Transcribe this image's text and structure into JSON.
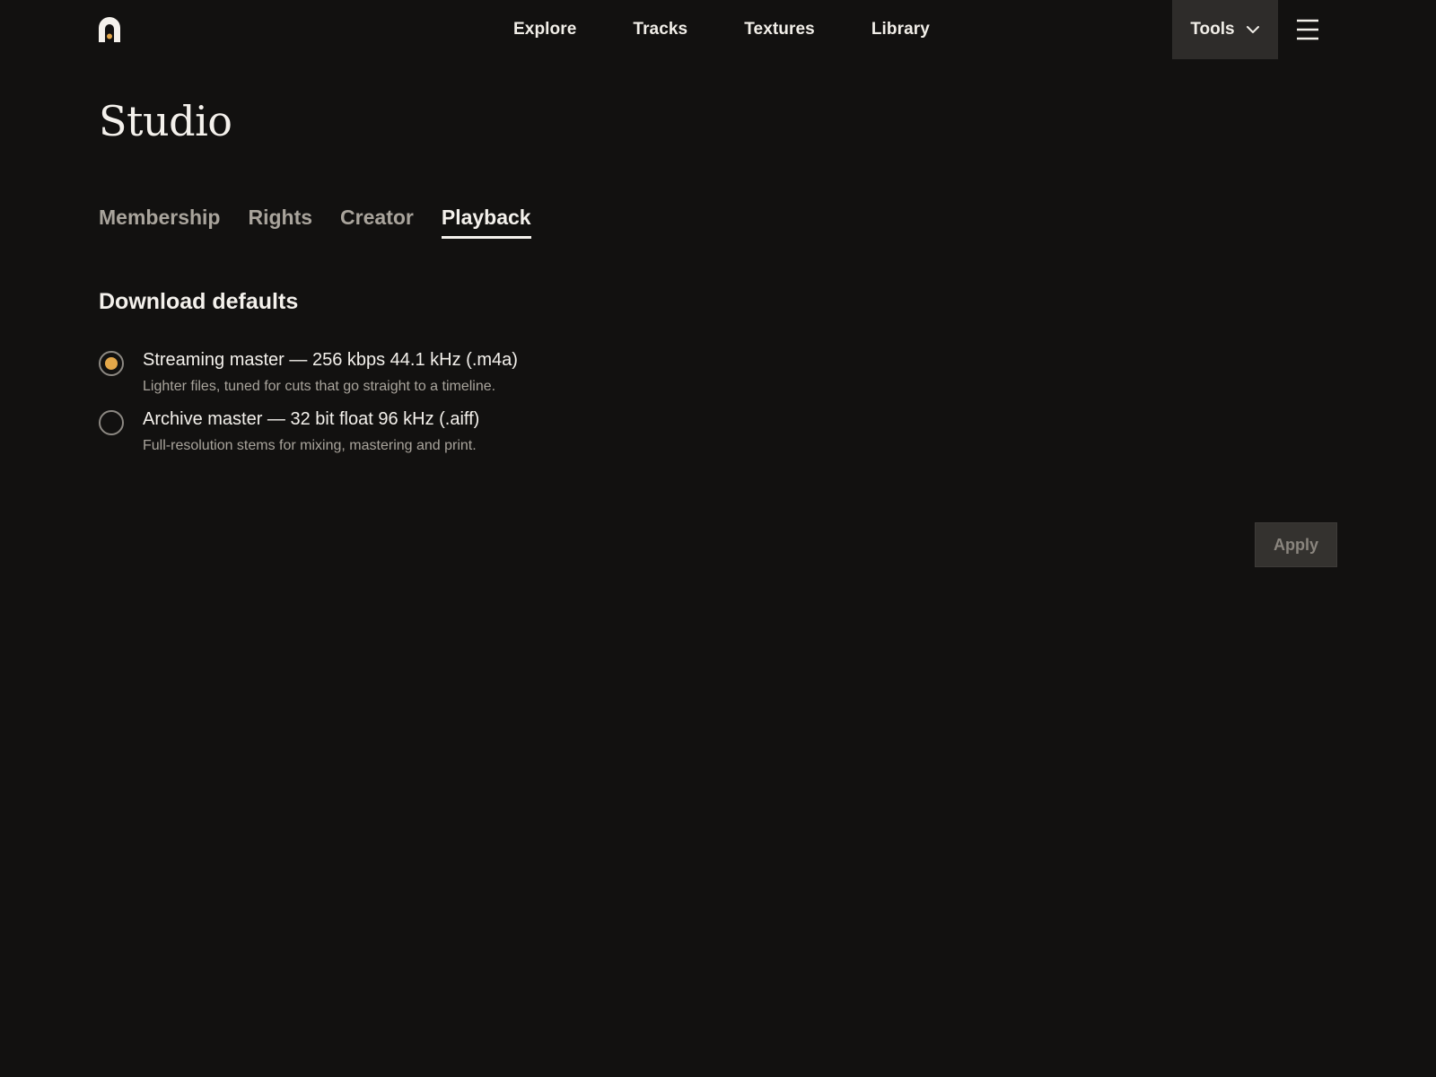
{
  "brand": {
    "logo_icon": "arch-logo-icon",
    "accent_color": "#e3a749"
  },
  "nav": {
    "items": [
      {
        "label": "Explore"
      },
      {
        "label": "Tracks"
      },
      {
        "label": "Textures"
      },
      {
        "label": "Library"
      }
    ],
    "tools_label": "Tools",
    "tools_icon": "chevron-down-icon",
    "menu_icon": "hamburger-menu-icon"
  },
  "page": {
    "title": "Studio"
  },
  "tabs": [
    {
      "label": "Membership",
      "active": false
    },
    {
      "label": "Rights",
      "active": false
    },
    {
      "label": "Creator",
      "active": false
    },
    {
      "label": "Playback",
      "active": true
    }
  ],
  "download_defaults": {
    "heading": "Download defaults",
    "options": [
      {
        "label": "Streaming master — 256 kbps 44.1 kHz (.m4a)",
        "description": "Lighter files, tuned for cuts that go straight to a timeline.",
        "selected": true
      },
      {
        "label": "Archive master — 32 bit float 96 kHz (.aiff)",
        "description": "Full-resolution stems for mixing, mastering and print.",
        "selected": false
      }
    ]
  },
  "actions": {
    "apply_label": "Apply",
    "apply_enabled": false
  }
}
